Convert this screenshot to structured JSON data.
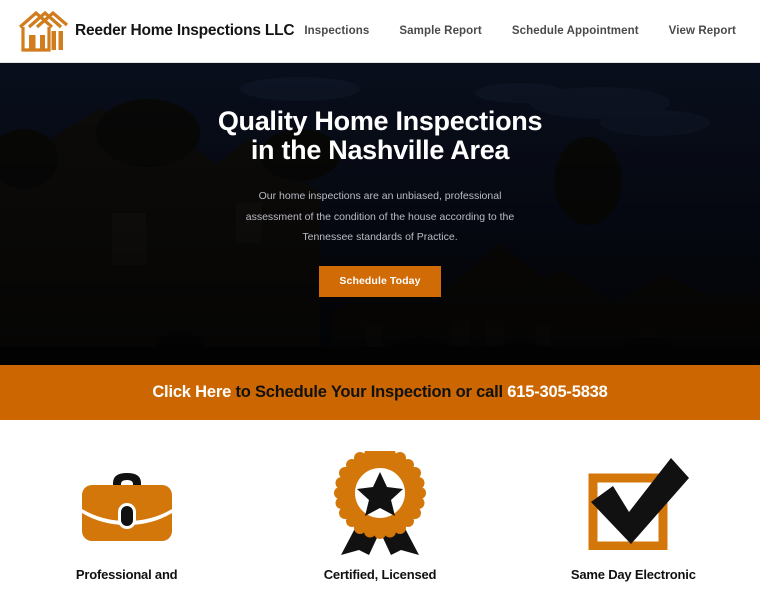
{
  "header": {
    "logo_icon": "house-logo-icon",
    "brand_name": "Reeder Home Inspections LLC",
    "nav": [
      {
        "label": "Inspections"
      },
      {
        "label": "Sample Report"
      },
      {
        "label": "Schedule Appointment"
      },
      {
        "label": "View Report"
      }
    ]
  },
  "hero": {
    "title": "Quality Home Inspections in the Nashville Area",
    "subtitle": "Our home inspections are an unbiased, professional assessment of the condition of the house according to the Tennessee standards of Practice.",
    "cta_label": "Schedule Today",
    "background_image": "night-suburban-houses-photo"
  },
  "banner": {
    "link_text": "Click Here",
    "middle_text": " to Schedule Your Inspection or call ",
    "phone": "615-305-5838"
  },
  "features": [
    {
      "icon": "briefcase-icon",
      "title": "Professional and"
    },
    {
      "icon": "award-ribbon-icon",
      "title": "Certified, Licensed"
    },
    {
      "icon": "checkbox-check-icon",
      "title": "Same Day Electronic"
    }
  ],
  "colors": {
    "orange": "#cc6600",
    "orange_button": "#d06b06",
    "hero_dark": "#0a1020",
    "text_dark": "#141414",
    "nav_text": "#4a4a4a",
    "hero_sub_text": "#b9bcc4"
  }
}
